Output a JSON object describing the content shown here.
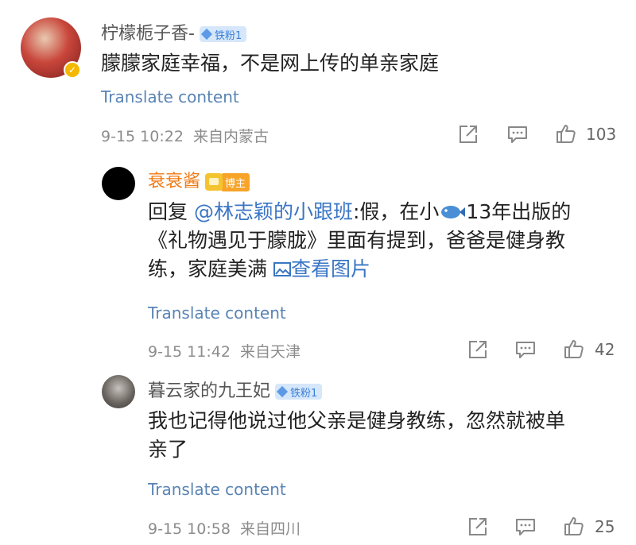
{
  "comments": [
    {
      "username": "柠檬栀子香-",
      "badge": "铁粉1",
      "text": "朦朦家庭幸福，不是网上传的单亲家庭",
      "translate": "Translate content",
      "timestamp": "9-15 10:22",
      "location": "来自内蒙古",
      "likes": "103"
    }
  ],
  "replies": [
    {
      "username": "衰衰酱",
      "badge": "博主",
      "reply_prefix": "回复",
      "mention": "@林志颖的小跟班",
      "text_line1_a": ":假，在小",
      "text_line1_b": "13年出版的",
      "text_line2": "《礼物遇见于朦胧》里面有提到，爸爸是健身教",
      "text_line3": "练，家庭美满",
      "image_link": "查看图片",
      "translate": "Translate content",
      "timestamp": "9-15 11:42",
      "location": "来自天津",
      "likes": "42"
    },
    {
      "username": "暮云家的九王妃",
      "badge": "铁粉1",
      "text_line1": "我也记得他说过他父亲是健身教练，忽然就被单",
      "text_line2": "亲了",
      "translate": "Translate content",
      "timestamp": "9-15 10:58",
      "location": "来自四川",
      "likes": "25"
    }
  ],
  "icons": {
    "share": "share-icon",
    "comment": "comment-icon",
    "like": "thumbs-up-icon",
    "verified": "verified-icon",
    "fish": "fish-emoji-icon",
    "image": "image-icon"
  },
  "colors": {
    "link": "#3a75c4",
    "translate": "#5a84b4",
    "blogger_name": "#f07a14",
    "verified": "#f5b800",
    "badge_bg": "#d6e7fb"
  }
}
